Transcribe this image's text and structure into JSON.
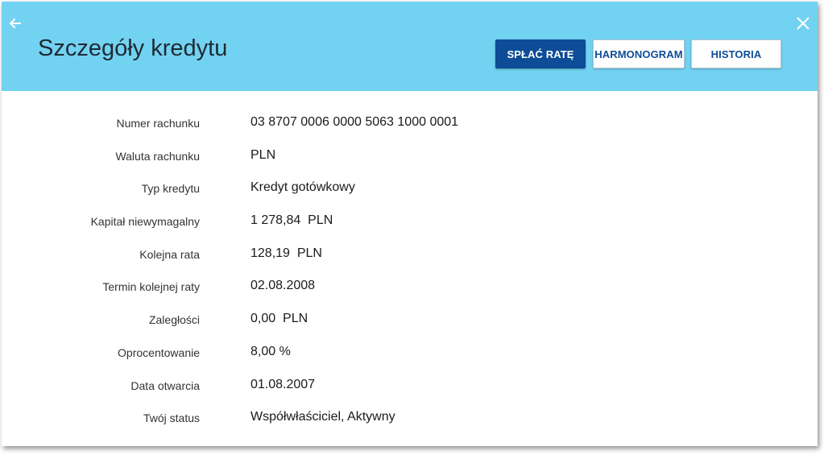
{
  "header": {
    "title": "Szczegóły kredytu",
    "back_icon": "arrow-left-icon",
    "close_icon": "close-icon",
    "buttons": {
      "pay": "SPŁAĆ RATĘ",
      "schedule": "HARMONOGRAM",
      "history": "HISTORIA"
    }
  },
  "colors": {
    "header_bg": "#72d2f2",
    "primary": "#0d4c97"
  },
  "details": [
    {
      "label": "Numer rachunku",
      "value": "03 8707 0006 0000 5063 1000 0001"
    },
    {
      "label": "Waluta rachunku",
      "value": "PLN"
    },
    {
      "label": "Typ kredytu",
      "value": "Kredyt gotówkowy"
    },
    {
      "label": "Kapitał niewymagalny",
      "value": "1 278,84  PLN"
    },
    {
      "label": "Kolejna rata",
      "value": "128,19  PLN"
    },
    {
      "label": "Termin kolejnej raty",
      "value": "02.08.2008"
    },
    {
      "label": "Zaległości",
      "value": "0,00  PLN"
    },
    {
      "label": "Oprocentowanie",
      "value": "8,00 %"
    },
    {
      "label": "Data otwarcia",
      "value": "01.08.2007"
    },
    {
      "label": "Twój status",
      "value": "Współwłaściciel, Aktywny"
    }
  ]
}
